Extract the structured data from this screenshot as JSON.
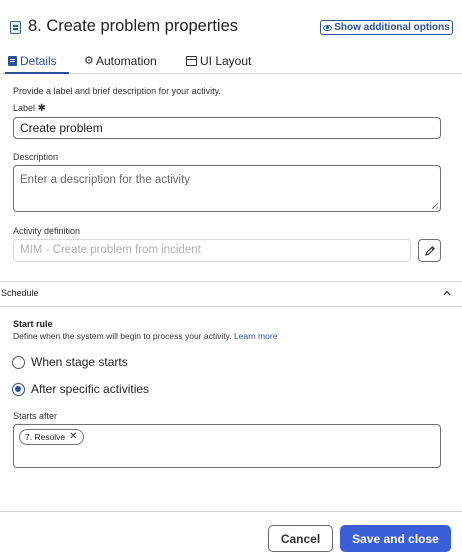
{
  "header": {
    "title": "8. Create problem properties",
    "show_options_label": "Show additional options"
  },
  "tabs": [
    {
      "label": "Details",
      "icon": "document-icon",
      "active": true
    },
    {
      "label": "Automation",
      "icon": "automation-icon",
      "active": false
    },
    {
      "label": "UI Layout",
      "icon": "layout-icon",
      "active": false
    }
  ],
  "details": {
    "intro": "Provide a label and brief description for your activity.",
    "label_label": "Label",
    "label_required": "✱",
    "label_value": "Create problem",
    "description_label": "Description",
    "description_placeholder": "Enter a description for the activity",
    "activity_definition_label": "Activity definition",
    "activity_definition_value": "MIM - Create problem from incident"
  },
  "schedule": {
    "title": "Schedule",
    "start_rule_title": "Start rule",
    "start_rule_desc": "Define when the system will begin to process your activity.",
    "learn_more": "Learn more",
    "options": [
      {
        "label": "When stage starts",
        "selected": false
      },
      {
        "label": "After specific activities",
        "selected": true
      }
    ],
    "starts_after_label": "Starts after",
    "starts_after_chips": [
      "7. Resolve"
    ]
  },
  "footer": {
    "cancel_label": "Cancel",
    "save_label": "Save and close"
  },
  "colors": {
    "accent": "#2a4f9e",
    "primary_button": "#3b5fd9"
  }
}
